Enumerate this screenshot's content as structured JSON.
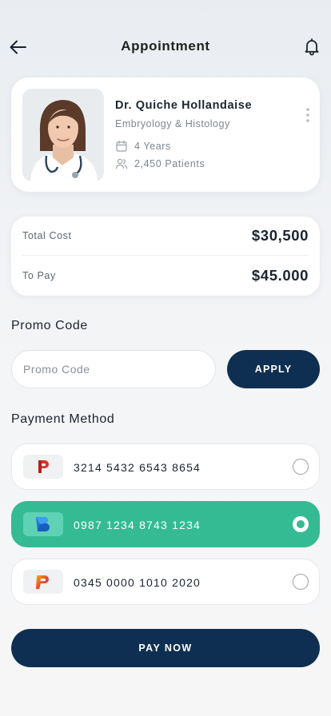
{
  "header": {
    "title": "Appointment",
    "back_icon": "arrow-left-icon",
    "notification_icon": "bell-icon"
  },
  "doctor": {
    "name": "Dr. Quiche Hollandaise",
    "specialty": "Embryology & Histology",
    "experience": "4 Years",
    "patients": "2,450 Patients",
    "experience_icon": "calendar-icon",
    "patients_icon": "users-icon",
    "menu_icon": "more-vertical-icon"
  },
  "costs": {
    "total_label": "Total Cost",
    "total_value": "$30,500",
    "pay_label": "To Pay",
    "pay_value": "$45.000"
  },
  "promo": {
    "title": "Promo Code",
    "placeholder": "Promo Code",
    "value": "",
    "apply_label": "APPLY"
  },
  "payment": {
    "title": "Payment Method",
    "methods": [
      {
        "number": "3214 5432 6543 8654",
        "selected": false,
        "logo_icon": "p-brand-logo-icon"
      },
      {
        "number": "0987 1234 8743 1234",
        "selected": true,
        "logo_icon": "b-brand-logo-icon"
      },
      {
        "number": "0345 0000 1010 2020",
        "selected": false,
        "logo_icon": "p-gradient-logo-icon"
      }
    ]
  },
  "pay_now_label": "PAY NOW",
  "colors": {
    "primary": "#0f2f52",
    "accent": "#35bb93",
    "background": "#f4f5f7"
  }
}
